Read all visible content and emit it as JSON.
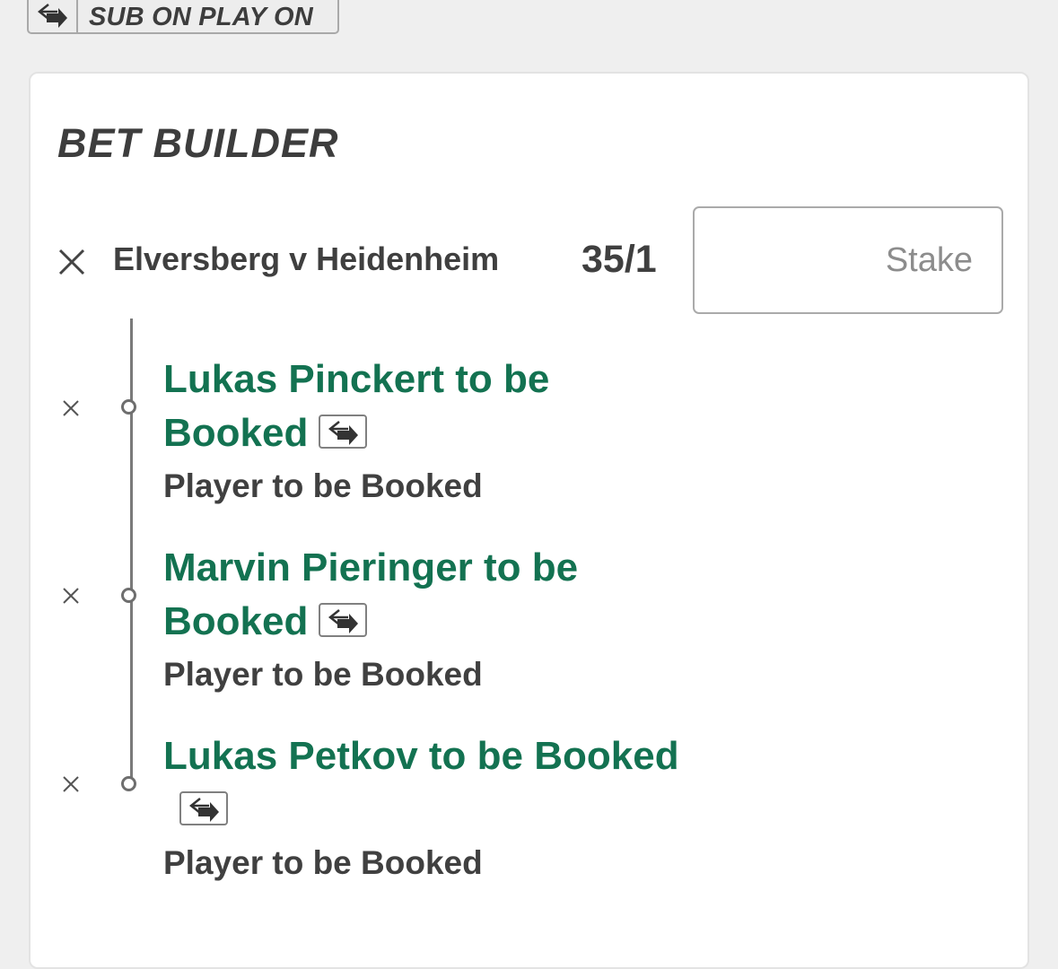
{
  "banner": {
    "label": "SUB ON PLAY ON",
    "icon": "swap-arrows-icon"
  },
  "bet_builder": {
    "title": "BET BUILDER",
    "match": "Elversberg v Heidenheim",
    "odds": "35/1",
    "stake_placeholder": "Stake",
    "stake_value": "",
    "legs": [
      {
        "title": "Lukas Pinckert to be Booked",
        "market": "Player to be Booked",
        "sub_on_play_on": true
      },
      {
        "title": "Marvin Pieringer to be Booked",
        "market": "Player to be Booked",
        "sub_on_play_on": true
      },
      {
        "title": "Lukas Petkov to be Booked",
        "market": "Player to be Booked",
        "sub_on_play_on": true
      }
    ]
  },
  "colors": {
    "background": "#efefef",
    "card": "#ffffff",
    "selection_green": "#137251",
    "text_dark": "#3d3d3d",
    "timeline": "#7a7a7a"
  }
}
